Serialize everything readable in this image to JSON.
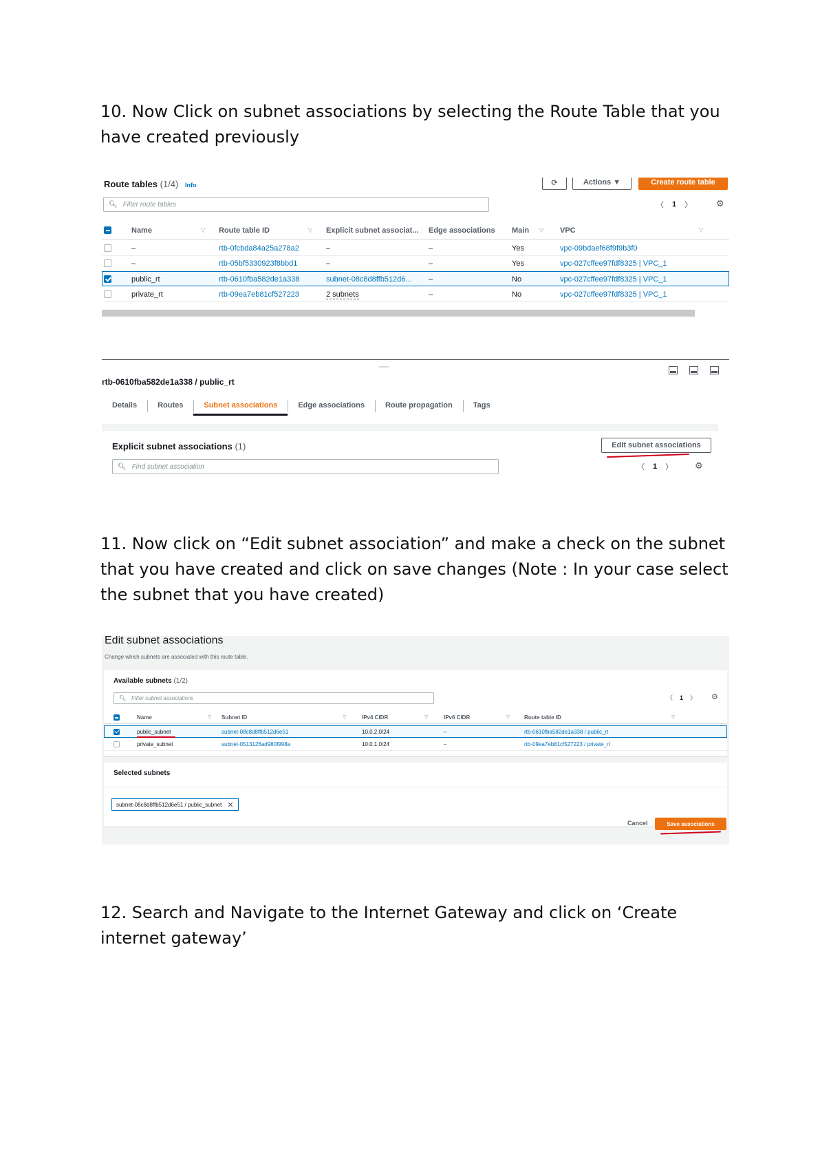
{
  "paragraphs": {
    "step10": "10. Now Click on subnet associations by selecting the Route Table that you have created previously",
    "step11": "11. Now click on “Edit subnet association” and make a check on the subnet that you have created and click on save changes (Note : In your case select the subnet  that you have created)",
    "step12": "12. Search and Navigate to the Internet Gateway and click on ‘Create internet gateway’"
  },
  "route_tables": {
    "title": "Route tables",
    "count": "(1/4)",
    "info": "Info",
    "refresh_icon": "refresh-icon",
    "actions_label": "Actions ▼",
    "create_label": "Create route table",
    "filter_placeholder": "Filter route tables",
    "page": "1",
    "columns": [
      "Name",
      "Route table ID",
      "Explicit subnet associat...",
      "Edge associations",
      "Main",
      "VPC"
    ],
    "rows": [
      {
        "name": "–",
        "id": "rtb-0fcbda84a25a278a2",
        "explicit": "–",
        "edge": "–",
        "main": "Yes",
        "vpc": "vpc-09bdaef68f9f9b3f0"
      },
      {
        "name": "–",
        "id": "rtb-05bf5330923f8bbd1",
        "explicit": "–",
        "edge": "–",
        "main": "Yes",
        "vpc": "vpc-027cffee97fdf8325 | VPC_1"
      },
      {
        "name": "public_rt",
        "id": "rtb-0610fba582de1a338",
        "explicit": "subnet-08c8d8ffb512d6...",
        "edge": "–",
        "main": "No",
        "vpc": "vpc-027cffee97fdf8325 | VPC_1"
      },
      {
        "name": "private_rt",
        "id": "rtb-09ea7eb81cf527223",
        "explicit": "2 subnets",
        "edge": "–",
        "main": "No",
        "vpc": "vpc-027cffee97fdf8325 | VPC_1"
      }
    ],
    "selected_row": 2,
    "detail_title": "rtb-0610fba582de1a338 / public_rt",
    "tabs": [
      "Details",
      "Routes",
      "Subnet associations",
      "Edge associations",
      "Route propagation",
      "Tags"
    ],
    "active_tab": "Subnet associations",
    "explicit_title": "Explicit subnet associations",
    "explicit_count": "(1)",
    "edit_label": "Edit subnet associations",
    "find_placeholder": "Find subnet association",
    "page2": "1"
  },
  "edit_subnet": {
    "title": "Edit subnet associations",
    "subtitle": "Change which subnets are associated with this route table.",
    "available_title": "Available subnets",
    "available_count": "(1/2)",
    "filter_placeholder": "Filter subnet associations",
    "page": "1",
    "columns": [
      "Name",
      "Subnet ID",
      "IPv4 CIDR",
      "IPv6 CIDR",
      "Route table ID"
    ],
    "rows": [
      {
        "name": "public_subnet",
        "subnet_id": "subnet-08c8d8ffb512d6e51",
        "ipv4": "10.0.2.0/24",
        "ipv6": "–",
        "rt": "rtb-0610fba582de1a338 / public_rt"
      },
      {
        "name": "private_subnet",
        "subnet_id": "subnet-0513126ad980f998a",
        "ipv4": "10.0.1.0/24",
        "ipv6": "–",
        "rt": "rtb-09ea7eb81cf527223 / private_rt"
      }
    ],
    "selected_title": "Selected subnets",
    "chip": "subnet-08c8d8ffb512d6e51 / public_subnet",
    "cancel_label": "Cancel",
    "save_label": "Save associations"
  },
  "colors": {
    "accent": "#ec7211",
    "link": "#0073bb",
    "annotation": "#d0021b"
  }
}
